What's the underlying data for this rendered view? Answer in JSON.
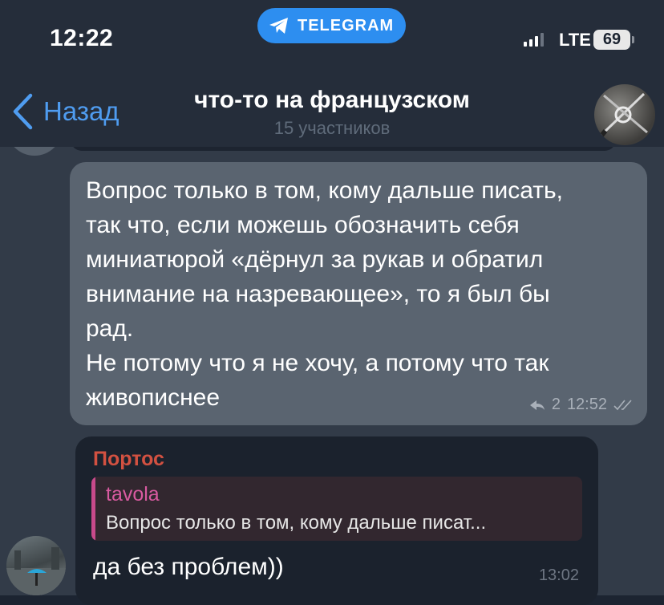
{
  "status_bar": {
    "time": "12:22",
    "return_app": "TELEGRAM",
    "network": "LTE",
    "battery": "69"
  },
  "header": {
    "back_label": "Назад",
    "title": "что-то на французском",
    "subtitle": "15 участников"
  },
  "messages": [
    {
      "type": "incoming",
      "text_lines": [
        "Вопрос только в том, кому дальше писать,",
        "так что, если можешь обозначить себя",
        "миниатюрой «дёрнул за рукав и обратил",
        "внимание на назревающее», то я был бы",
        "рад.",
        "Не потому что я не хочу, а потому что так",
        "живописнее"
      ],
      "replies_count": "2",
      "time": "12:52"
    },
    {
      "type": "incoming-reply",
      "sender": "Портос",
      "quote_name": "tavola",
      "quote_text": "Вопрос только в том, кому дальше писат...",
      "text": "да без проблем))",
      "time": "13:02"
    }
  ],
  "colors": {
    "accent": "#4f9cf0",
    "sender_name": "#d25141",
    "quote_name": "#d85aa0",
    "telegram_pill": "#2d8ef0"
  }
}
